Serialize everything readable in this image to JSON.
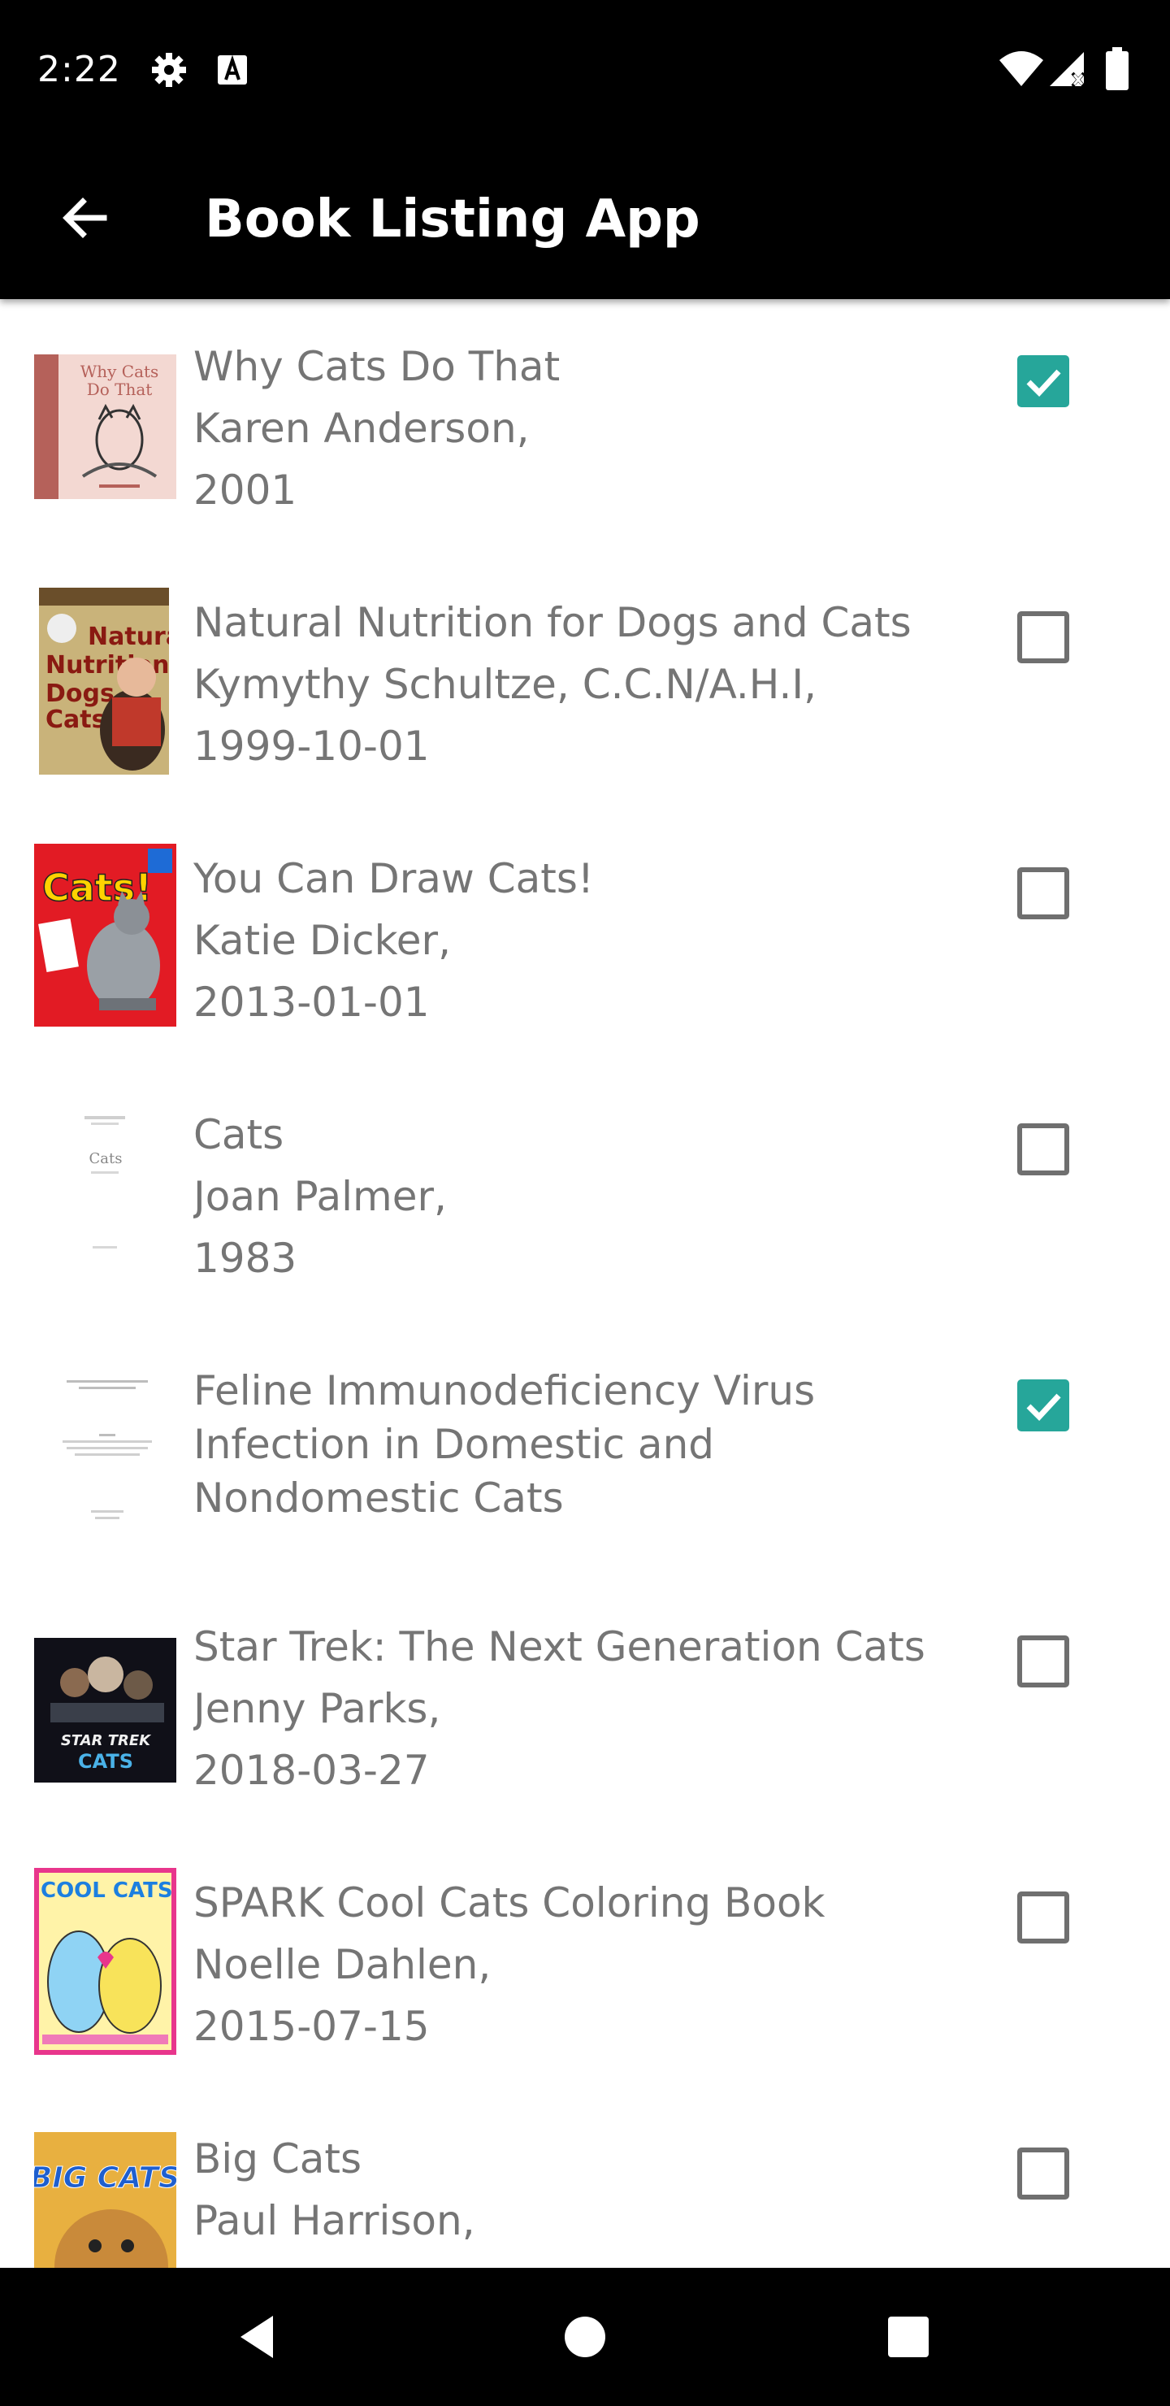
{
  "status_bar": {
    "time": "2:22",
    "left_icons": [
      "settings-icon",
      "keyboard-a-icon"
    ],
    "right_icons": [
      "wifi-icon",
      "signal-icon",
      "battery-icon"
    ]
  },
  "app_bar": {
    "title": "Book Listing App",
    "back_icon": "arrow-back-icon"
  },
  "colors": {
    "accent": "#26a69a",
    "text": "#757575",
    "bar": "#000000"
  },
  "books": [
    {
      "title": "Why Cats Do That",
      "lines": [
        "Why Cats Do That",
        "Karen Anderson,",
        "2001"
      ],
      "checked": true
    },
    {
      "title": "Natural Nutrition for Dogs and Cats",
      "lines": [
        "Natural Nutrition for Dogs and Cats",
        "Kymythy Schultze, C.C.N/A.H.I,",
        "1999-10-01"
      ],
      "checked": false
    },
    {
      "title": "You Can Draw Cats!",
      "lines": [
        "You Can Draw Cats!",
        "Katie Dicker,",
        "2013-01-01"
      ],
      "checked": false
    },
    {
      "title": "Cats",
      "lines": [
        "Cats",
        "Joan Palmer,",
        "1983"
      ],
      "checked": false
    },
    {
      "title": "Feline Immunodeficiency Virus Infection in Domestic and Nondomestic Cats",
      "lines": [
        "Feline Immunodeficiency Virus",
        "Infection in Domestic and",
        "Nondomestic Cats"
      ],
      "checked": true
    },
    {
      "title": "Star Trek: The Next Generation Cats",
      "lines": [
        "Star Trek: The Next Generation Cats",
        "Jenny Parks,",
        "2018-03-27"
      ],
      "checked": false
    },
    {
      "title": "SPARK Cool Cats Coloring Book",
      "lines": [
        "SPARK Cool Cats Coloring Book",
        "Noelle Dahlen,",
        "2015-07-15"
      ],
      "checked": false
    },
    {
      "title": "Big Cats",
      "lines": [
        "Big Cats",
        "Paul Harrison,"
      ],
      "checked": false
    }
  ],
  "cover_text": {
    "why_cats": [
      "Why Cats",
      "Do That"
    ],
    "natural_nutrition": [
      "Natural",
      "Nutrition",
      "Dogs",
      "Cats"
    ],
    "you_can_draw": [
      "Cats!"
    ],
    "cats": [
      "Cats"
    ],
    "star_trek": [
      "STAR TREK",
      "CATS"
    ],
    "cool_cats": [
      "COOL CATS"
    ],
    "big_cats": [
      "BIG CATS"
    ]
  },
  "nav_bar": {
    "icons": [
      "back-triangle-icon",
      "home-circle-icon",
      "recents-square-icon"
    ]
  }
}
